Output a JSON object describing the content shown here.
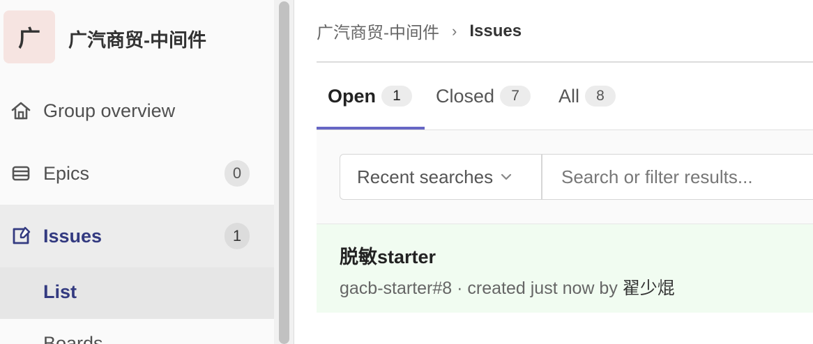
{
  "sidebar": {
    "group_avatar_letter": "广",
    "group_name": "广汽商贸-中间件",
    "items": [
      {
        "label": "Group overview",
        "icon": "home-icon"
      },
      {
        "label": "Epics",
        "icon": "epic-icon",
        "count": "0"
      },
      {
        "label": "Issues",
        "icon": "issues-icon",
        "count": "1",
        "active": true
      }
    ],
    "sub_items": [
      {
        "label": "List",
        "active": true
      },
      {
        "label": "Boards"
      }
    ]
  },
  "breadcrumb": {
    "parent": "广汽商贸-中间件",
    "current": "Issues"
  },
  "tabs": [
    {
      "label": "Open",
      "count": "1",
      "active": true
    },
    {
      "label": "Closed",
      "count": "7"
    },
    {
      "label": "All",
      "count": "8"
    }
  ],
  "filter": {
    "recent_searches_label": "Recent searches",
    "search_placeholder": "Search or filter results..."
  },
  "issues": [
    {
      "title": "脱敏starter",
      "reference": "gacb-starter#8",
      "meta_middle": " · created just now by ",
      "author": "翟少焜"
    }
  ],
  "colors": {
    "accent": "#6666c4",
    "active_text": "#333a80",
    "issue_row_bg": "#f1fcf1"
  }
}
